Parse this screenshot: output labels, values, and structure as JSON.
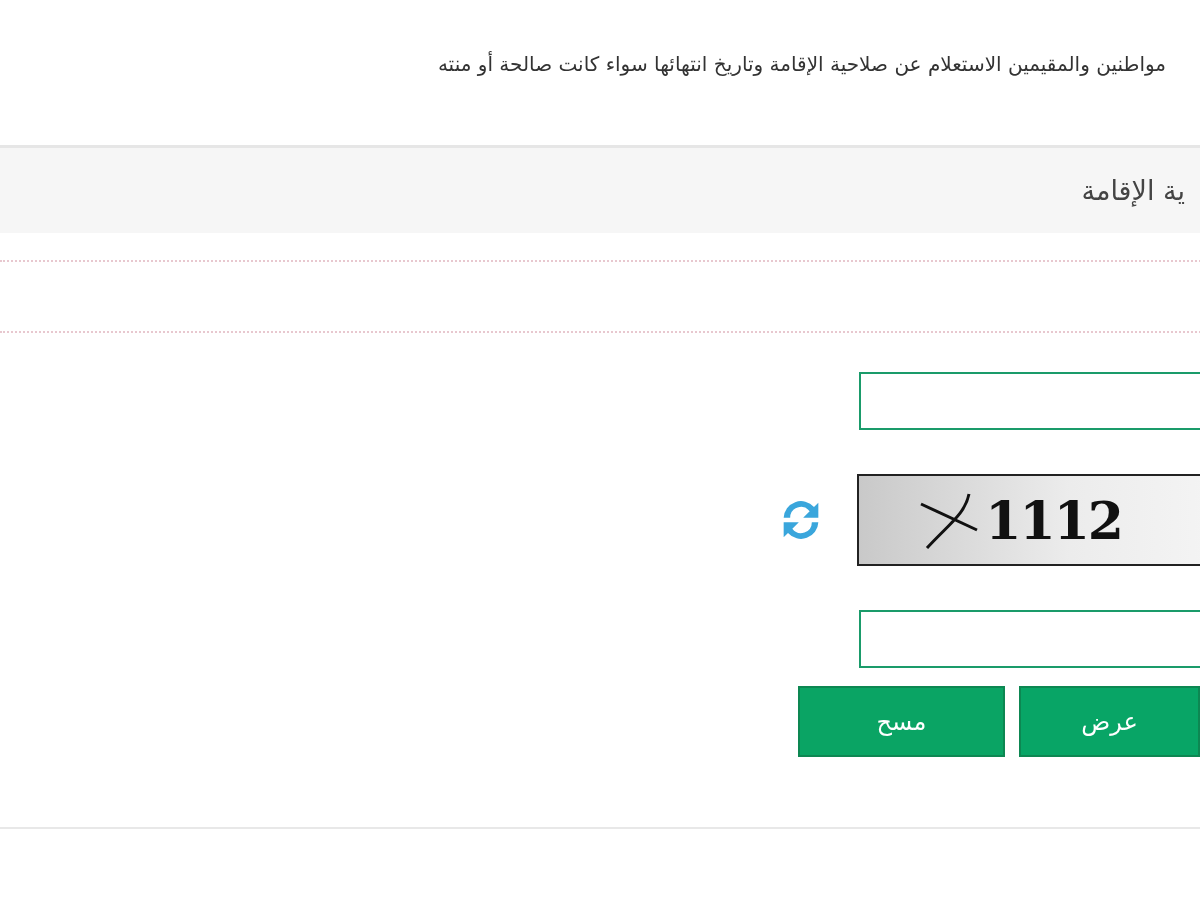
{
  "intro": "مواطنين والمقيمين الاستعلام عن صلاحية الإقامة وتاريخ انتهائها سواء كانت صالحة أو منته",
  "panel": {
    "title": "ية الإقامة"
  },
  "captcha": {
    "code": "1112"
  },
  "buttons": [
    {
      "label": "عرض",
      "kind": "submit"
    },
    {
      "label": "مسح",
      "kind": "reset"
    }
  ]
}
